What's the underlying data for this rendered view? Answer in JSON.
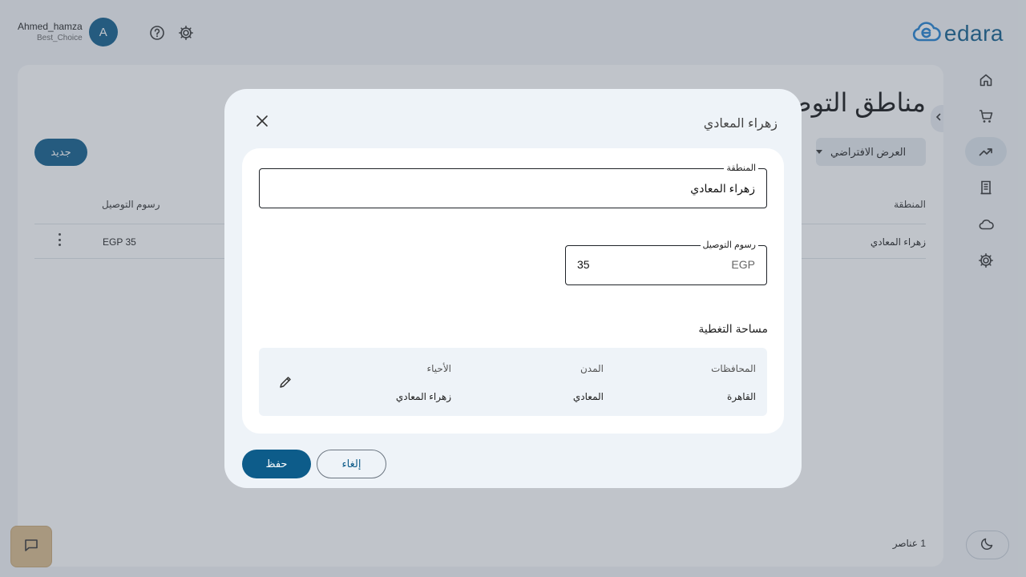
{
  "user": {
    "name": "Ahmed_hamza",
    "org": "Best_Choice",
    "avatar_letter": "A"
  },
  "header": {
    "help_icon": "help-circle-icon",
    "settings_icon": "gear-icon",
    "logo_text": "edara",
    "logo_icon": "cloud-logo-icon"
  },
  "rail": {
    "items": [
      {
        "icon": "home-icon",
        "active": false
      },
      {
        "icon": "cart-icon",
        "active": false
      },
      {
        "icon": "trending-up-icon",
        "active": true
      },
      {
        "icon": "receipt-icon",
        "active": false
      },
      {
        "icon": "cloud-icon",
        "active": false
      },
      {
        "icon": "gear-icon",
        "active": false
      }
    ],
    "theme_icon": "moon-icon"
  },
  "page": {
    "title": "مناطق التوصيل",
    "new_button": "جديد",
    "view_select": "العرض الافتراضي",
    "columns": {
      "region": "المنطقة",
      "fee": "رسوم التوصيل"
    },
    "rows": [
      {
        "region": "زهراء المعادي",
        "fee": "EGP 35"
      }
    ],
    "count": "1 عناصر"
  },
  "dialog": {
    "title": "زهراء المعادي",
    "region_field": {
      "label": "المنطقة",
      "value": "زهراء المعادي"
    },
    "fee_field": {
      "label": "رسوم التوصيل",
      "prefix": "EGP",
      "value": "35"
    },
    "coverage": {
      "title": "مساحة التغطية",
      "headers": {
        "governorates": "المحافظات",
        "cities": "المدن",
        "districts": "الأحياء"
      },
      "values": {
        "governorates": "القاهرة",
        "cities": "المعادي",
        "districts": "زهراء المعادي"
      }
    },
    "save_label": "حفظ",
    "cancel_label": "إلغاء"
  },
  "colors": {
    "primary": "#0d5c8a",
    "chat_fab": "#d9ba8a"
  }
}
